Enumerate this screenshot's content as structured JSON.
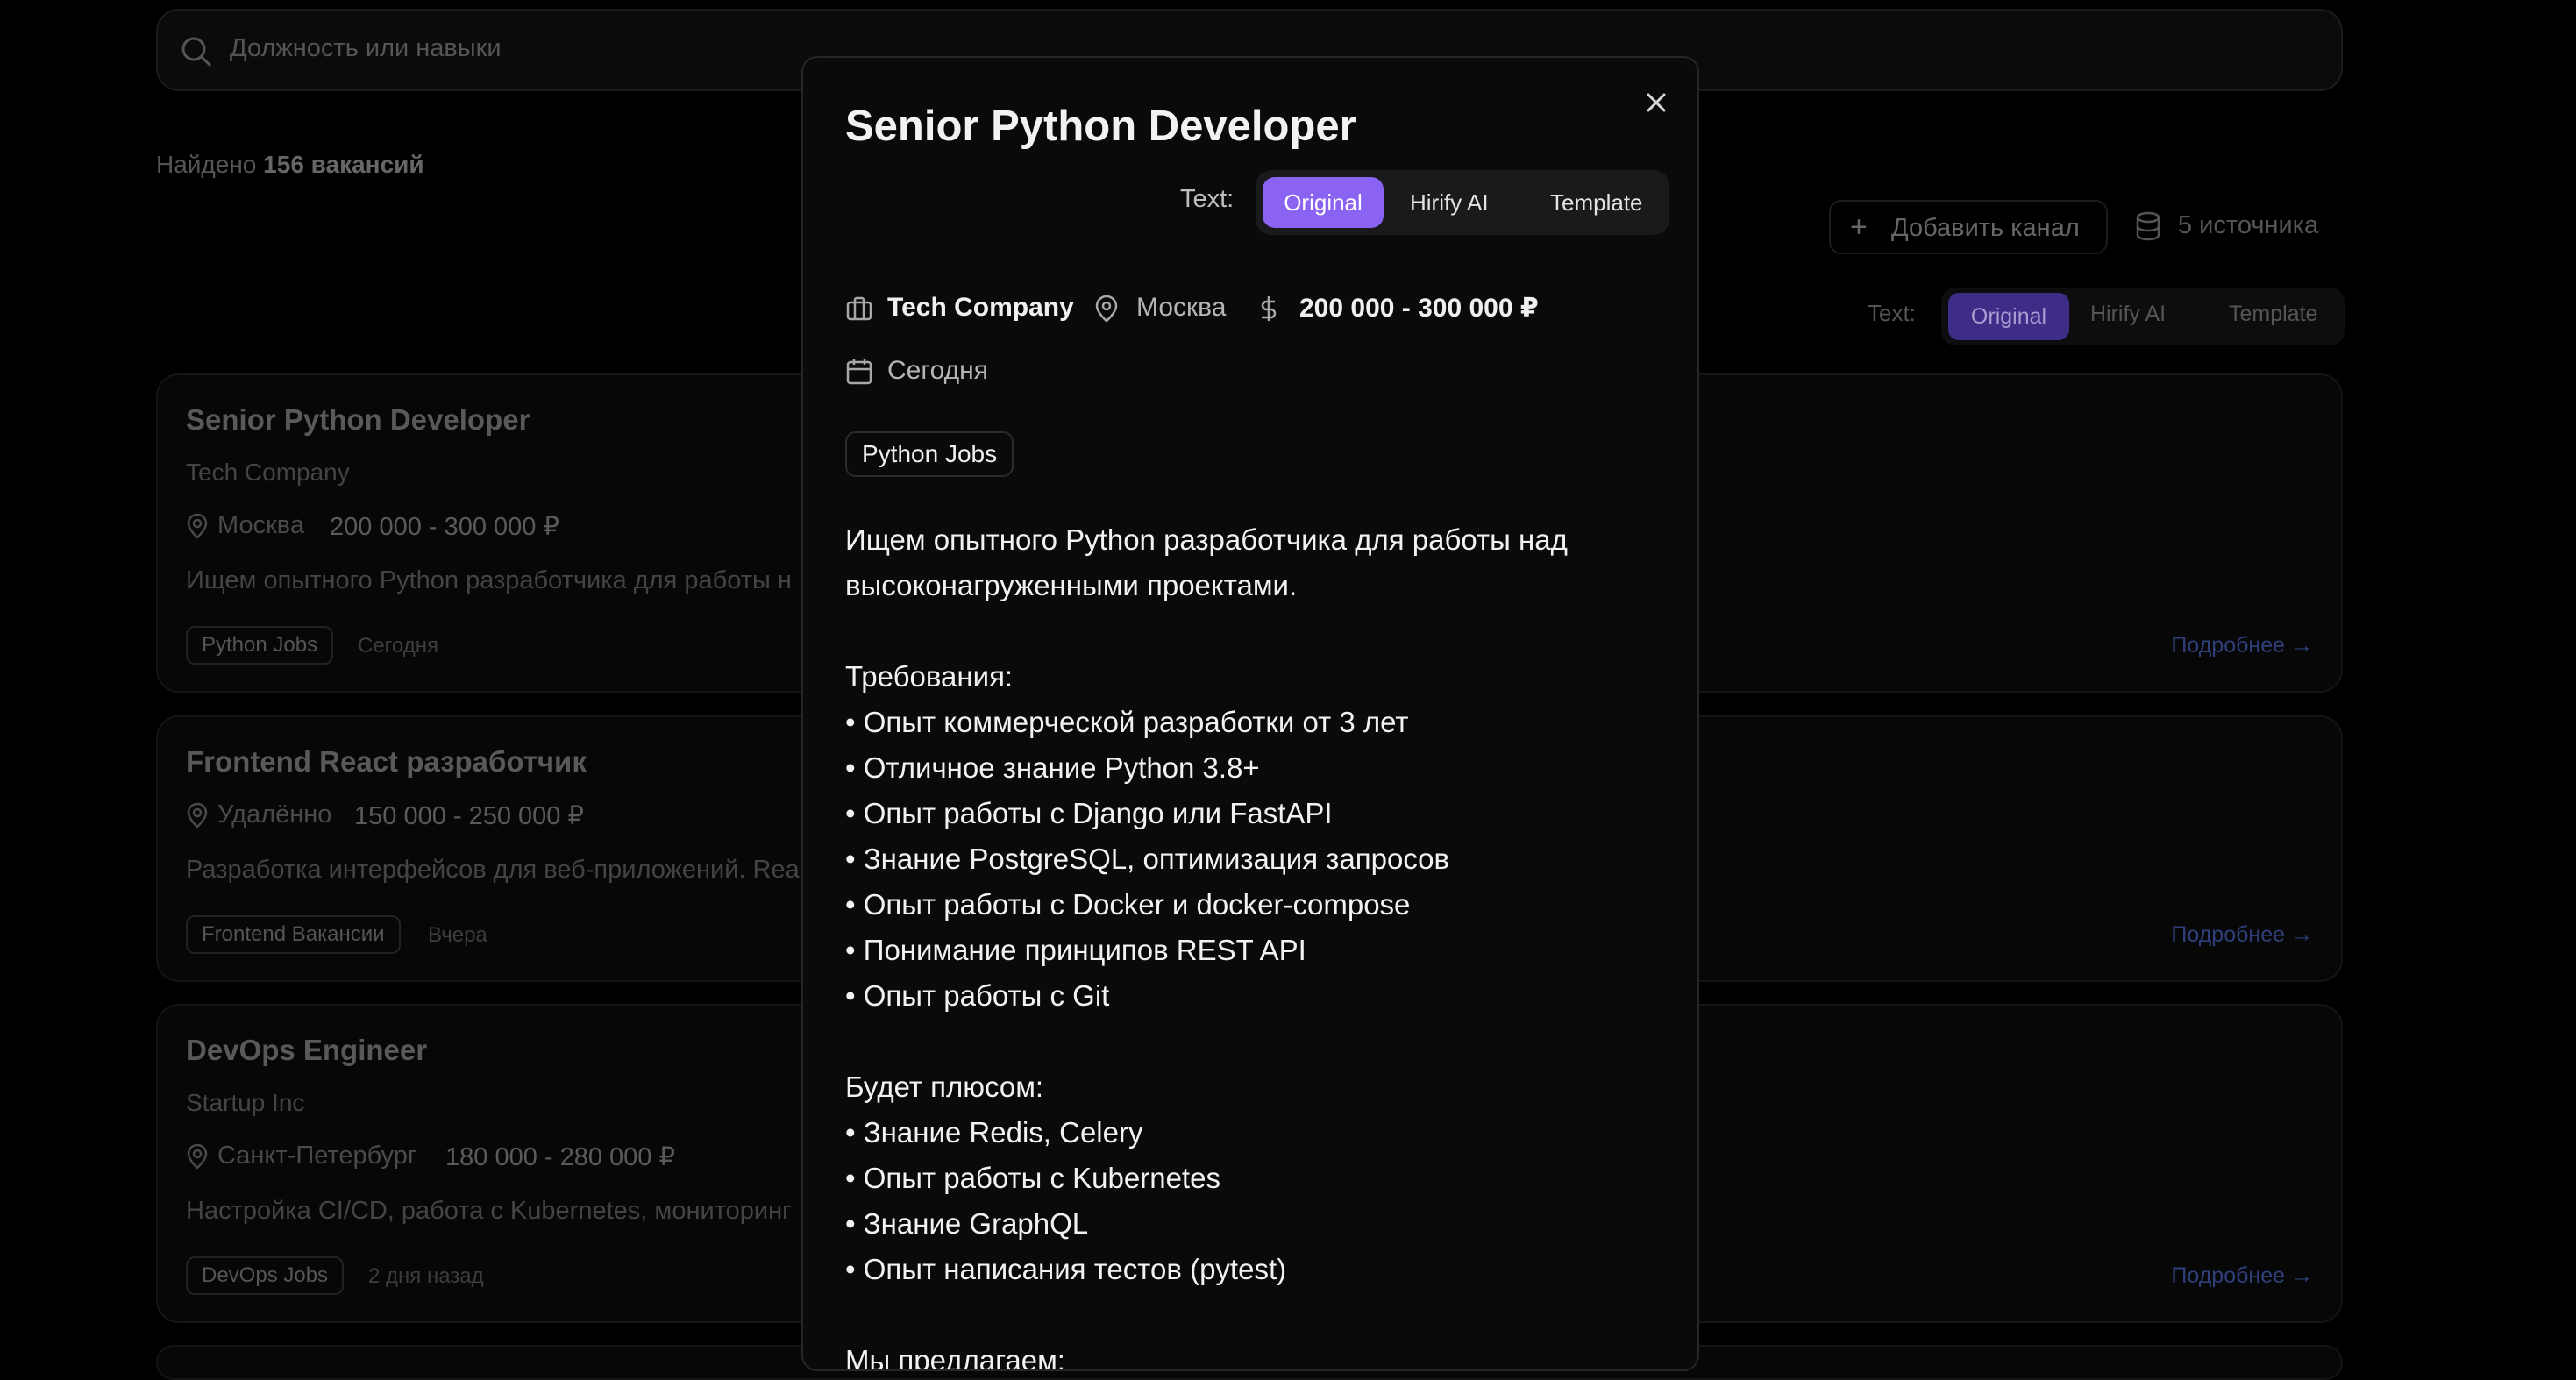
{
  "search": {
    "placeholder": "Должность или навыки"
  },
  "results": {
    "prefix": "Найдено",
    "count": "156 вакансий"
  },
  "toolbar": {
    "add_channel": "Добавить канал",
    "sources": "5 источника"
  },
  "text_toggle": {
    "label": "Text:",
    "options": [
      "Original",
      "Hirify AI",
      "Template"
    ],
    "selected": "Original"
  },
  "jobs": [
    {
      "title": "Senior Python Developer",
      "company": "Tech Company",
      "location": "Москва",
      "salary": "200 000 - 300 000 ₽",
      "desc": "Ищем опытного Python разработчика для работы н",
      "tag": "Python Jobs",
      "date": "Сегодня",
      "more": "Подробнее →"
    },
    {
      "title": "Frontend React разработчик",
      "location": "Удалённо",
      "salary": "150 000 - 250 000 ₽",
      "desc": "Разработка интерфейсов для веб-приложений. Rea",
      "tag": "Frontend Вакансии",
      "date": "Вчера",
      "more": "Подробнее →"
    },
    {
      "title": "DevOps Engineer",
      "company": "Startup Inc",
      "location": "Санкт-Петербург",
      "salary": "180 000 - 280 000 ₽",
      "desc": "Настройка CI/CD, работа с Kubernetes, мониторинг",
      "tag": "DevOps Jobs",
      "date": "2 дня назад",
      "more": "Подробнее →"
    }
  ],
  "modal": {
    "title": "Senior Python Developer",
    "company": "Tech Company",
    "location": "Москва",
    "salary": "200 000 - 300 000 ₽",
    "date": "Сегодня",
    "tag": "Python Jobs",
    "body": [
      "Ищем опытного Python разработчика для работы над",
      "высоконагруженными проектами.",
      "",
      "Требования:",
      "• Опыт коммерческой разработки от 3 лет",
      "• Отличное знание Python 3.8+",
      "• Опыт работы с Django или FastAPI",
      "• Знание PostgreSQL, оптимизация запросов",
      "• Опыт работы с Docker и docker-compose",
      "• Понимание принципов REST API",
      "• Опыт работы с Git",
      "",
      "Будет плюсом:",
      "• Знание Redis, Celery",
      "• Опыт работы с Kubernetes",
      "• Знание GraphQL",
      "• Опыт написания тестов (pytest)",
      "",
      "Мы предлагаем:"
    ]
  },
  "colors": {
    "accent": "#8b63f2",
    "background": "#000000",
    "modal_bg": "#0a0a0b",
    "link": "#2e3f7a"
  }
}
